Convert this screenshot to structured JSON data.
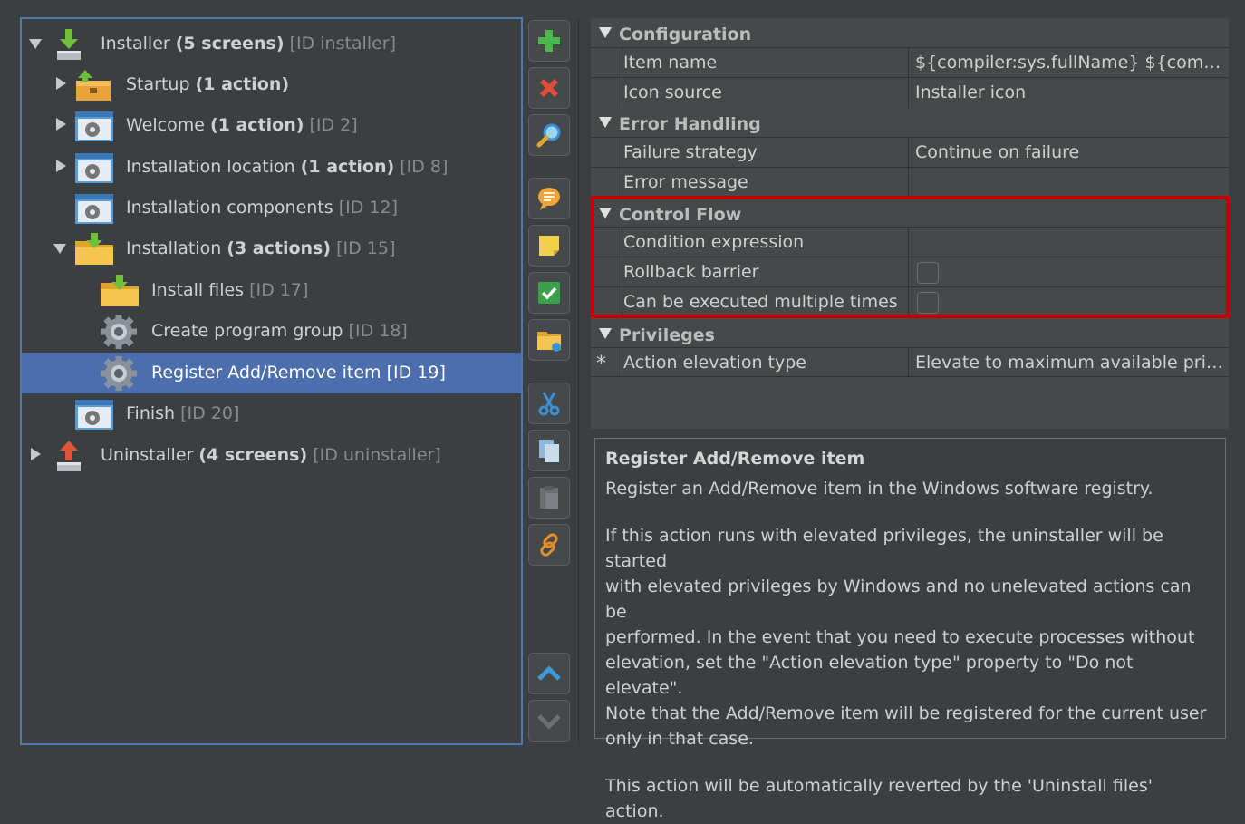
{
  "tree": {
    "items": [
      {
        "name": "Installer",
        "bold": "(5 screens)",
        "id": "[ID installer]"
      },
      {
        "name": "Startup",
        "bold": "(1 action)",
        "id": ""
      },
      {
        "name": "Welcome",
        "bold": "(1 action)",
        "id": "[ID 2]"
      },
      {
        "name": "Installation location",
        "bold": "(1 action)",
        "id": "[ID 8]"
      },
      {
        "name": "Installation components",
        "bold": "",
        "id": "[ID 12]"
      },
      {
        "name": "Installation",
        "bold": "(3 actions)",
        "id": "[ID 15]"
      },
      {
        "name": "Install files",
        "bold": "",
        "id": "[ID 17]"
      },
      {
        "name": "Create program group",
        "bold": "",
        "id": "[ID 18]"
      },
      {
        "name": "Register Add/Remove item",
        "bold": "",
        "id": "[ID 19]"
      },
      {
        "name": "Finish",
        "bold": "",
        "id": "[ID 20]"
      },
      {
        "name": "Uninstaller",
        "bold": "(4 screens)",
        "id": "[ID uninstaller]"
      }
    ]
  },
  "toolbar": {
    "icons": [
      "add-icon",
      "delete-icon",
      "search-icon",
      "comment-icon",
      "note-icon",
      "check-icon",
      "folder-icon",
      "cut-icon",
      "copy-icon",
      "paste-icon",
      "link-icon",
      "move-up-icon",
      "move-down-icon"
    ]
  },
  "properties": {
    "configuration": {
      "title": "Configuration",
      "item_name_label": "Item name",
      "item_name_value": "${compiler:sys.fullName} ${compiler:sys.version}",
      "icon_source_label": "Icon source",
      "icon_source_value": "Installer icon"
    },
    "error_handling": {
      "title": "Error Handling",
      "failure_strategy_label": "Failure strategy",
      "failure_strategy_value": "Continue on failure",
      "error_message_label": "Error message",
      "error_message_value": ""
    },
    "control_flow": {
      "title": "Control Flow",
      "condition_label": "Condition expression",
      "condition_value": "",
      "rollback_label": "Rollback barrier",
      "rollback_checked": false,
      "multiple_label": "Can be executed multiple times",
      "multiple_checked": false
    },
    "privileges": {
      "title": "Privileges",
      "marker": "*",
      "elevation_label": "Action elevation type",
      "elevation_value": "Elevate to maximum available privileges"
    }
  },
  "description": {
    "title": "Register Add/Remove item",
    "line1": "Register an Add/Remove item in the Windows software registry.",
    "para2": [
      "If this action runs with elevated privileges, the uninstaller will be started",
      "with elevated privileges by Windows and no unelevated actions can be",
      "performed. In the event that you need to execute processes without",
      "elevation, set the \"Action elevation type\" property to \"Do not elevate\".",
      "Note that the Add/Remove item will be registered for the current user",
      "only in that case."
    ],
    "para3": "This action will be automatically reverted by the 'Uninstall files' action."
  },
  "colors": {
    "background": "#3c3f41",
    "selection": "#4b6eaf",
    "highlight_border": "#c40000",
    "tree_border": "#4d79b0"
  }
}
